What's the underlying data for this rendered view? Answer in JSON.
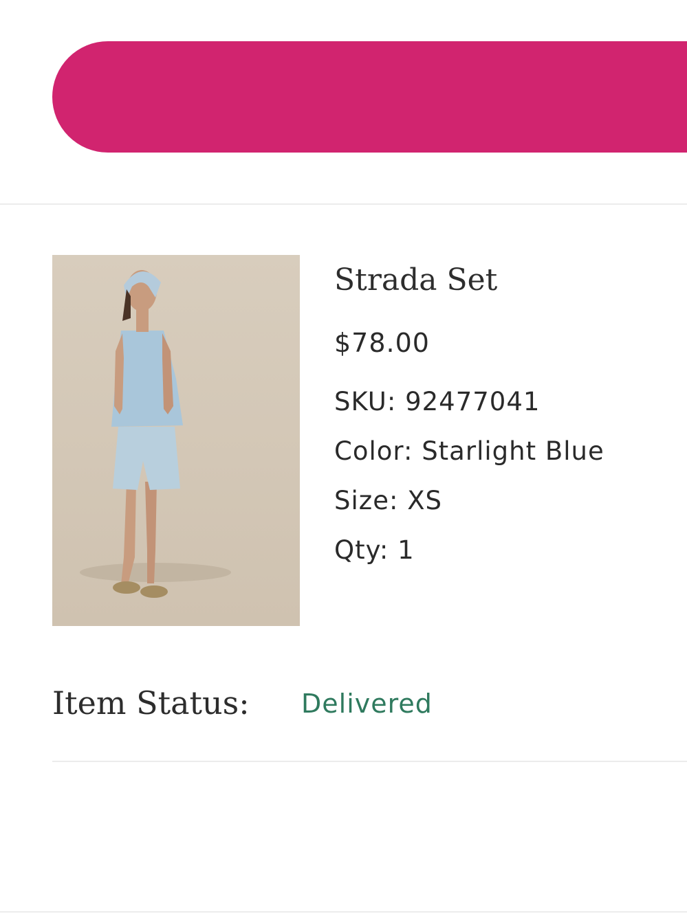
{
  "banner": {
    "accent_color": "#d1246f"
  },
  "item": {
    "name": "Strada Set",
    "price": "$78.00",
    "sku_label": "SKU:",
    "sku_value": "92477041",
    "color_label": "Color:",
    "color_value": "Starlight Blue",
    "size_label": "Size:",
    "size_value": "XS",
    "qty_label": "Qty:",
    "qty_value": "1",
    "image_icon": "product-photo-model-in-blue-top-and-shorts"
  },
  "status": {
    "label": "Item Status:",
    "value": "Delivered",
    "value_color": "#2f7a5e"
  }
}
